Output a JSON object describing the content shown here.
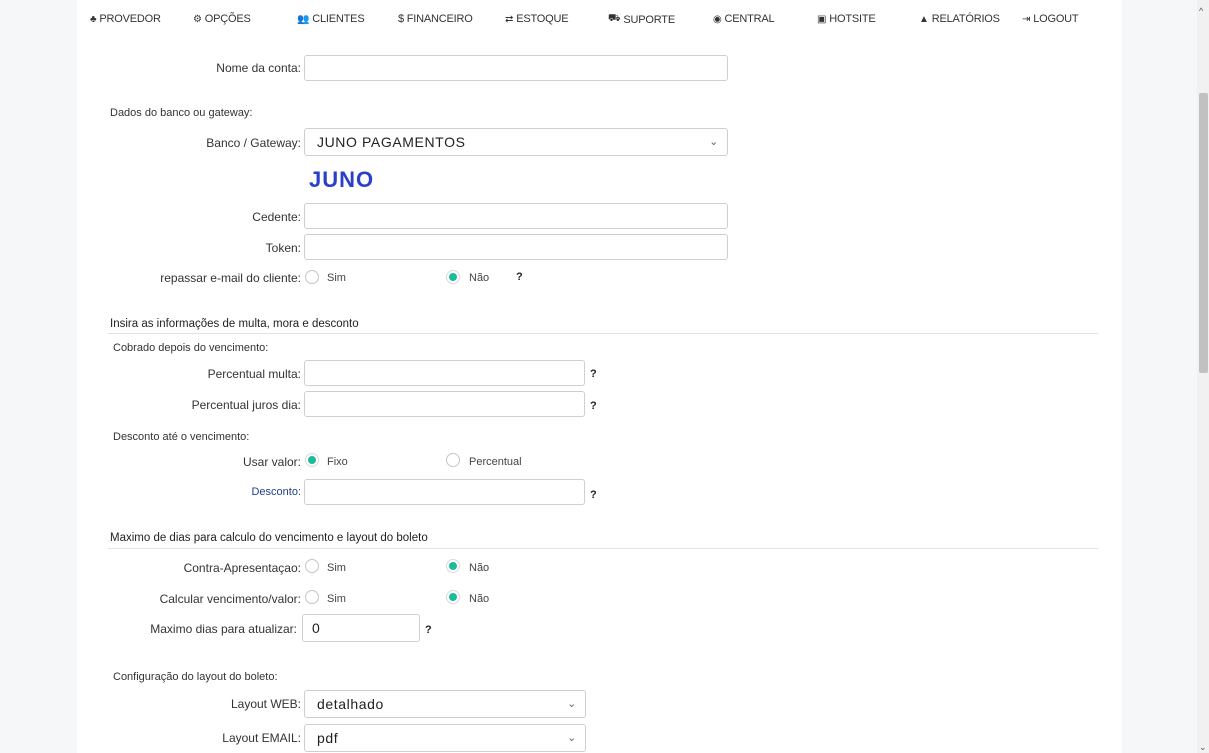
{
  "nav": {
    "items": [
      {
        "label": "PROVEDOR",
        "icon": "sitemap-icon",
        "glyph": "♣"
      },
      {
        "label": "OPÇÕES",
        "icon": "cogs-icon",
        "glyph": "⚙"
      },
      {
        "label": "CLIENTES",
        "icon": "users-icon",
        "glyph": "👥"
      },
      {
        "label": "$ FINANCEIRO",
        "icon": "",
        "glyph": ""
      },
      {
        "label": "ESTOQUE",
        "icon": "exchange-icon",
        "glyph": "⇄"
      },
      {
        "label": "SUPORTE",
        "icon": "truck-icon",
        "glyph": "⛟"
      },
      {
        "label": "CENTRAL",
        "icon": "globe-icon",
        "glyph": "◉"
      },
      {
        "label": "HOTSITE",
        "icon": "html5-icon",
        "glyph": "▣"
      },
      {
        "label": "RELATÓRIOS",
        "icon": "area-chart-icon",
        "glyph": "▲"
      },
      {
        "label": "LOGOUT",
        "icon": "sign-out-icon",
        "glyph": "⇥"
      }
    ]
  },
  "form": {
    "nome_conta": {
      "label": "Nome da conta:",
      "value": ""
    },
    "dados_banco_title": "Dados do banco ou gateway:",
    "banco": {
      "label": "Banco / Gateway:",
      "value": "JUNO PAGAMENTOS"
    },
    "logo_text": "JUNO",
    "cedente": {
      "label": "Cedente:",
      "value": ""
    },
    "token": {
      "label": "Token:",
      "value": ""
    },
    "repassar": {
      "label": "repassar e-mail do cliente:",
      "opt_sim": "Sim",
      "opt_nao": "Não",
      "help": "?"
    },
    "multa_title": "Insira as informações de multa, mora e desconto",
    "cobrado_title": "Cobrado depois do vencimento:",
    "perc_multa": {
      "label": "Percentual multa:",
      "value": "",
      "help": "?"
    },
    "perc_juros": {
      "label": "Percentual juros dia:",
      "value": "",
      "help": "?"
    },
    "desconto_title": "Desconto até o vencimento:",
    "usar_valor": {
      "label": "Usar valor:",
      "opt_fixo": "Fixo",
      "opt_percentual": "Percentual"
    },
    "desconto": {
      "label": "Desconto:",
      "value": "",
      "help": "?"
    },
    "maximo_title": "Maximo de dias para calculo do vencimento e layout do boleto",
    "contra": {
      "label": "Contra-Apresentaçao:",
      "opt_sim": "Sim",
      "opt_nao": "Não"
    },
    "calcular": {
      "label": "Calcular vencimento/valor:",
      "opt_sim": "Sim",
      "opt_nao": "Não"
    },
    "max_dias": {
      "label": "Maximo dias para atualizar:",
      "value": "0",
      "help": "?"
    },
    "layout_title": "Configuração do layout do boleto:",
    "layout_web": {
      "label": "Layout WEB:",
      "value": "detalhado"
    },
    "layout_email": {
      "label": "Layout EMAIL:",
      "value": "pdf"
    }
  },
  "colors": {
    "radio_selected": "#1abc9c",
    "logo": "#2b3fc9",
    "desconto_label": "#1f3f8f"
  }
}
